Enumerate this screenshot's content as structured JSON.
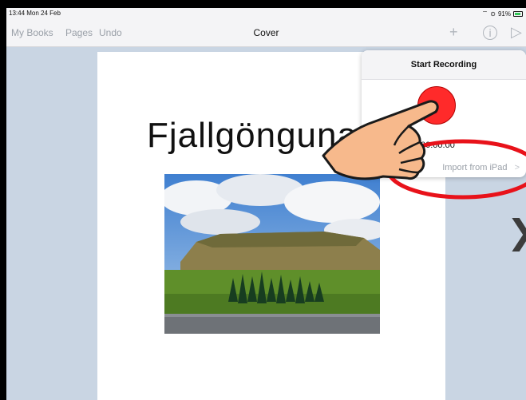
{
  "status_bar": {
    "time": "13:44 Mon 24 Feb",
    "battery": "91%"
  },
  "navbar": {
    "my_books": "My Books",
    "pages": "Pages",
    "undo": "Undo",
    "title": "Cover",
    "add_icon": "plus-icon",
    "info_icon": "info-icon",
    "play_icon": "play-icon"
  },
  "page": {
    "title": "Fjallgönguna"
  },
  "popover": {
    "header": "Start Recording",
    "elapsed": "00:00:00",
    "import_label": "Import from iPad",
    "import_chevron": ">"
  },
  "colors": {
    "background": "#c9d5e3",
    "record": "#ff2a2a",
    "annotation": "#e8121a",
    "hand": "#f7b98c"
  }
}
